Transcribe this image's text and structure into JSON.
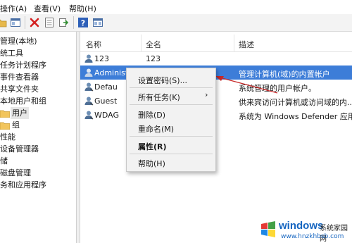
{
  "menubar": {
    "action": "操作(A)",
    "view": "查看(V)",
    "help": "帮助(H)"
  },
  "toolbar": {
    "icons": [
      "folder-icon",
      "console-tree-icon",
      "delete-icon",
      "properties-icon",
      "export-icon",
      "help-icon",
      "view-icon"
    ]
  },
  "tree": {
    "items": [
      "管理(本地)",
      "统工具",
      "任务计划程序",
      "事件查看器",
      "共享文件夹",
      "本地用户和组",
      "用户",
      "组",
      "性能",
      "设备管理器",
      "储",
      "磁盘管理",
      "务和应用程序"
    ]
  },
  "list": {
    "headers": {
      "name": "名称",
      "fullname": "全名",
      "desc": "描述"
    },
    "rows": [
      {
        "name": "123",
        "fullname": "123",
        "desc": ""
      },
      {
        "name": "Administrat...",
        "fullname": "",
        "desc": "管理计算机(域)的内置帐户"
      },
      {
        "name": "Defau",
        "fullname": "",
        "desc": "系统管理的用户帐户。"
      },
      {
        "name": "Guest",
        "fullname": "",
        "desc": "供来宾访问计算机或访问域的内..."
      },
      {
        "name": "WDAG",
        "fullname": "",
        "desc": "系统为 Windows Defender 应用..."
      }
    ]
  },
  "context_menu": {
    "set_password": "设置密码(S)...",
    "all_tasks": "所有任务(K)",
    "delete": "删除(D)",
    "rename": "重命名(M)",
    "properties": "属性(R)",
    "help": "帮助(H)"
  },
  "watermark": {
    "brand": "windows",
    "site_cn": "系统家园网",
    "url": "www.hnzkhbsb.com"
  },
  "colors": {
    "selection": "#3d7dd8",
    "accent_arrow": "#c62828"
  }
}
